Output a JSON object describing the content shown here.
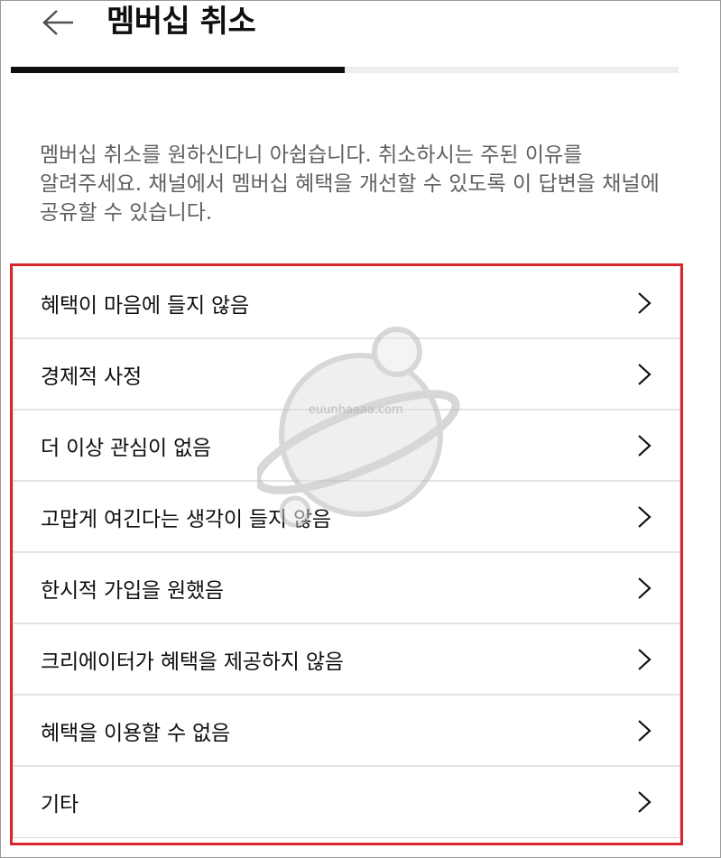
{
  "header": {
    "back_icon": "arrow-left-icon",
    "title": "멤버십 취소"
  },
  "progress": {
    "fraction": 0.5
  },
  "description": "멤버십 취소를 원하신다니 아쉽습니다. 취소하시는 주된 이유를 알려주세요. 채널에서 멤버십 혜택을 개선할 수 있도록 이 답변을 채널에 공유할 수 있습니다.",
  "reasons": [
    {
      "label": "혜택이 마음에 들지 않음"
    },
    {
      "label": "경제적 사정"
    },
    {
      "label": "더 이상 관심이 없음"
    },
    {
      "label": "고맙게 여긴다는 생각이 들지 않음"
    },
    {
      "label": "한시적 가입을 원했음"
    },
    {
      "label": "크리에이터가 혜택을 제공하지 않음"
    },
    {
      "label": "혜택을 이용할 수 없음"
    },
    {
      "label": "기타"
    }
  ],
  "watermark": {
    "text": "euunhaaaa.com",
    "icon": "planet-icon"
  },
  "colors": {
    "highlight_border": "#d9252d",
    "progress_fill": "#0f0f0f",
    "progress_track": "#eeeeee",
    "description_text": "#606060"
  }
}
